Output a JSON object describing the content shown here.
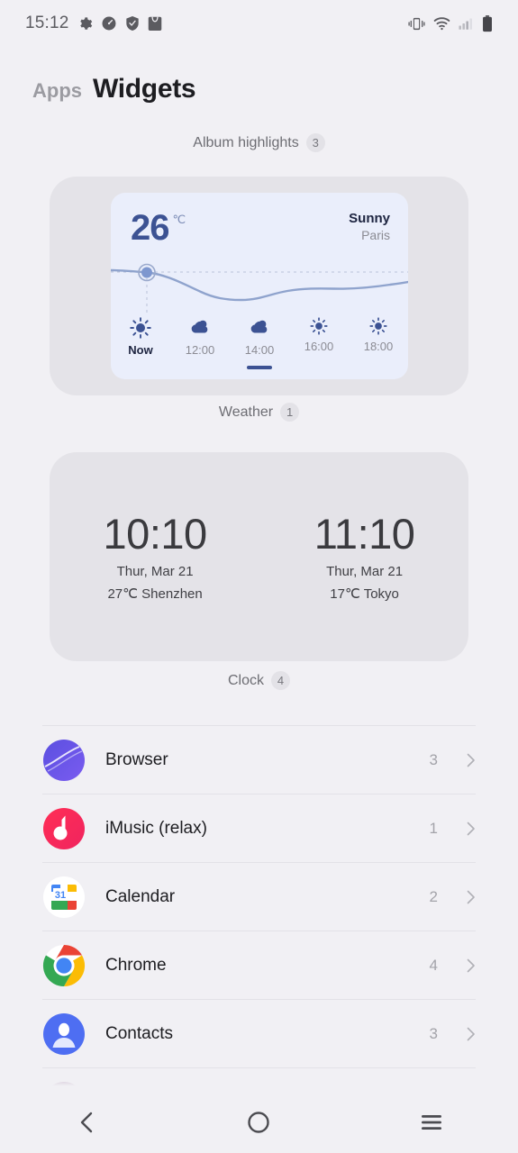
{
  "statusbar": {
    "time": "15:12",
    "left_icons": [
      "gear-icon",
      "speedometer-icon",
      "shield-icon",
      "bag-icon"
    ],
    "right_icons": [
      "vibrate-icon",
      "wifi-icon",
      "signal-icon",
      "battery-icon"
    ]
  },
  "header": {
    "tab_apps": "Apps",
    "tab_widgets": "Widgets"
  },
  "sections": {
    "album": {
      "label": "Album highlights",
      "count": "3"
    },
    "weather": {
      "label": "Weather",
      "count": "1"
    },
    "clock": {
      "label": "Clock",
      "count": "4"
    }
  },
  "weather_widget": {
    "temperature": "26",
    "unit": "℃",
    "condition": "Sunny",
    "city": "Paris",
    "selected_hour": "14:00",
    "hours": [
      {
        "label": "Now",
        "icon": "sun-icon",
        "active": true
      },
      {
        "label": "12:00",
        "icon": "cloud-icon",
        "active": false
      },
      {
        "label": "14:00",
        "icon": "cloud-icon",
        "active": false
      },
      {
        "label": "16:00",
        "icon": "sun-small-icon",
        "active": false
      },
      {
        "label": "18:00",
        "icon": "sun-small-icon",
        "active": false
      }
    ],
    "accent_color": "#3c5293",
    "card_color": "#eaeefb"
  },
  "clock_widget": {
    "clocks": [
      {
        "time": "10:10",
        "date": "Thur,  Mar 21",
        "meta": "27℃  Shenzhen"
      },
      {
        "time": "11:10",
        "date": "Thur,  Mar 21",
        "meta": "17℃  Tokyo"
      }
    ]
  },
  "apps": [
    {
      "name": "Browser",
      "count": "3",
      "icon": "browser-icon"
    },
    {
      "name": "iMusic (relax)",
      "count": "1",
      "icon": "imusic-icon"
    },
    {
      "name": "Calendar",
      "count": "2",
      "icon": "calendar-icon"
    },
    {
      "name": "Chrome",
      "count": "4",
      "icon": "chrome-icon"
    },
    {
      "name": "Contacts",
      "count": "3",
      "icon": "contacts-icon"
    }
  ],
  "navbar": {
    "back": "back-button",
    "home": "home-button",
    "recents": "recents-button"
  }
}
